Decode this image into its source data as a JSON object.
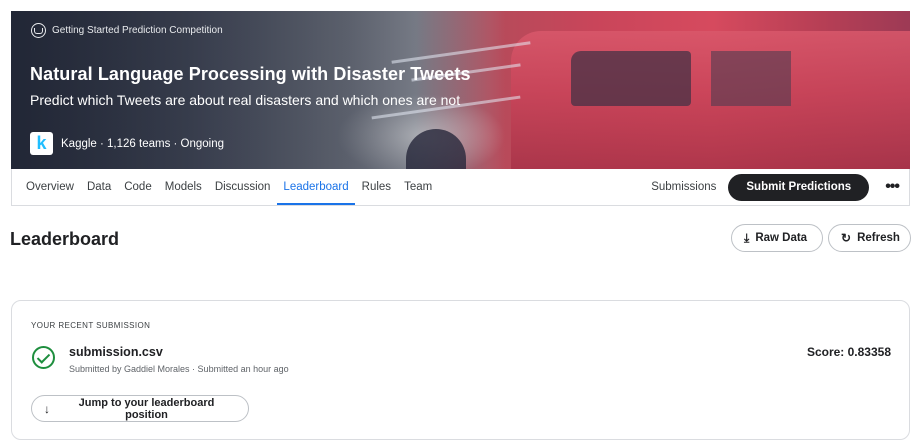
{
  "banner": {
    "competition_type": "Getting Started Prediction Competition",
    "title": "Natural Language Processing with Disaster Tweets",
    "subtitle": "Predict which Tweets are about real disasters and which ones are not",
    "org_logo_letter": "k",
    "org_meta": "Kaggle · 1,126 teams · Ongoing"
  },
  "nav": {
    "tabs": [
      {
        "label": "Overview",
        "active": false
      },
      {
        "label": "Data",
        "active": false
      },
      {
        "label": "Code",
        "active": false
      },
      {
        "label": "Models",
        "active": false
      },
      {
        "label": "Discussion",
        "active": false
      },
      {
        "label": "Leaderboard",
        "active": true
      },
      {
        "label": "Rules",
        "active": false
      },
      {
        "label": "Team",
        "active": false
      }
    ],
    "submissions_label": "Submissions",
    "submit_label": "Submit Predictions",
    "more_glyph": "•••"
  },
  "page": {
    "title": "Leaderboard",
    "raw_data_label": "Raw Data",
    "raw_data_icon": "download-icon",
    "refresh_label": "Refresh",
    "refresh_icon": "refresh-icon"
  },
  "submission": {
    "section_label": "YOUR RECENT SUBMISSION",
    "file_name": "submission.csv",
    "meta": "Submitted by Gaddiel Morales · Submitted an hour ago",
    "score": "Score: 0.83358",
    "jump_label": "Jump to your leaderboard position",
    "status_icon": "check-circle-icon"
  },
  "colors": {
    "accent": "#1a73e8",
    "success": "#1e8e3e",
    "primary_button": "#202124"
  }
}
